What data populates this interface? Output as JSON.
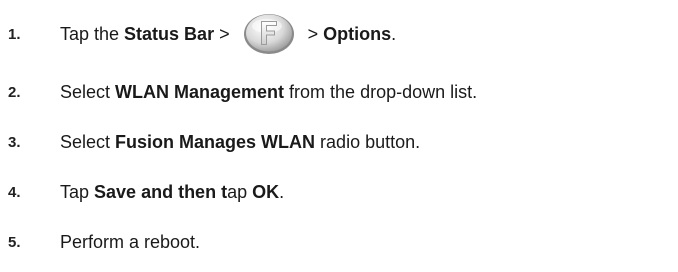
{
  "steps": [
    {
      "number": "1.",
      "parts": {
        "a": "Tap the ",
        "b": "Status Bar",
        "c": " > ",
        "icon": "fusion-icon",
        "d": " > ",
        "e": "Options",
        "f": "."
      }
    },
    {
      "number": "2.",
      "parts": {
        "a": "Select ",
        "b": "WLAN Management",
        "c": " from the drop-down list."
      }
    },
    {
      "number": "3.",
      "parts": {
        "a": "Select ",
        "b": "Fusion Manages WLAN",
        "c": " radio button."
      }
    },
    {
      "number": "4.",
      "parts": {
        "a": "Tap ",
        "b": "Save and then t",
        "c": "ap ",
        "d": "OK",
        "e": "."
      }
    },
    {
      "number": "5.",
      "parts": {
        "a": "Perform a reboot."
      }
    }
  ],
  "colors": {
    "text": "#1a1a1a",
    "icon_bezel": "#8a8a8a",
    "icon_face": "#d9d9d9"
  }
}
